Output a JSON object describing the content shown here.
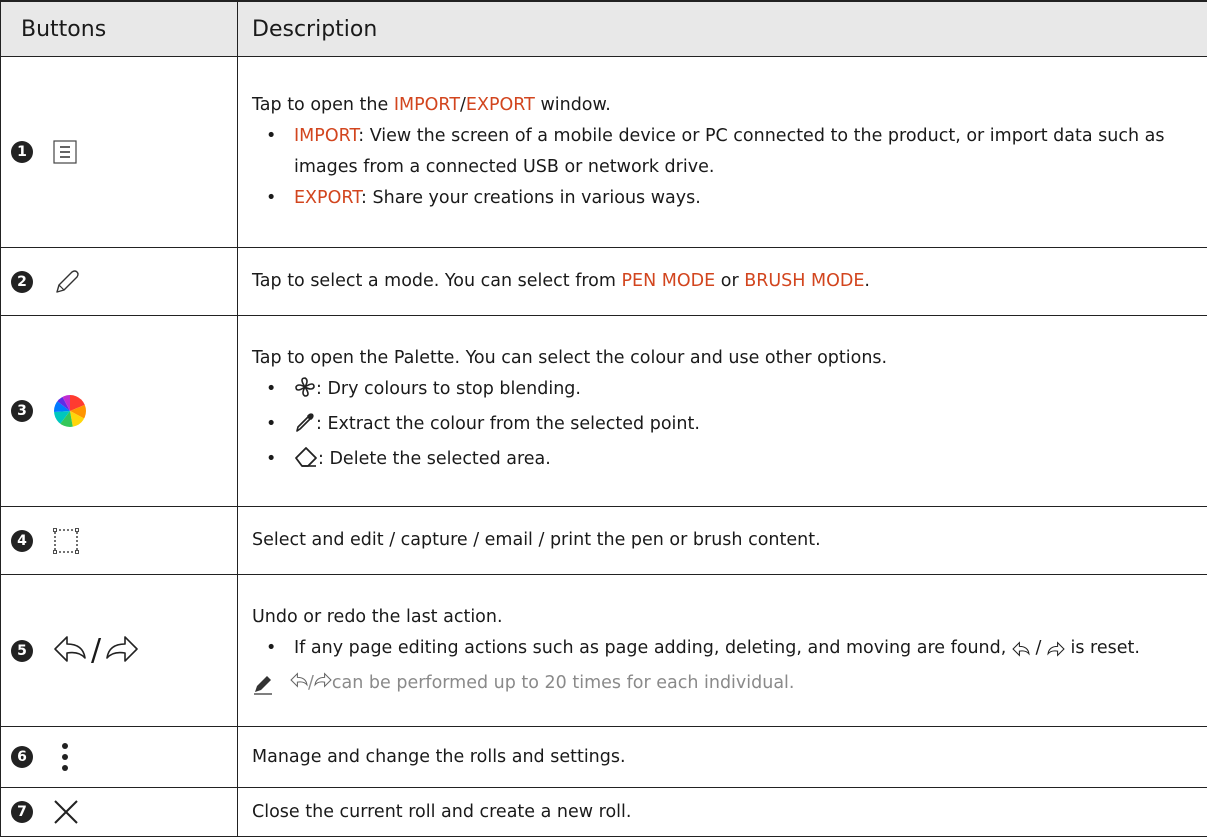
{
  "header": {
    "col1": "Buttons",
    "col2": "Description"
  },
  "rows": [
    {
      "num": "1",
      "intro_pre": "Tap to open the ",
      "intro_hl1": "IMPORT",
      "intro_sep": "/",
      "intro_hl2": "EXPORT",
      "intro_post": " window.",
      "b1_hl": "IMPORT",
      "b1_text": ": View the screen of a mobile device or PC connected to the product, or import data such as images from a connected USB or network drive.",
      "b2_hl": "EXPORT",
      "b2_text": ": Share your creations in various ways."
    },
    {
      "num": "2",
      "pre": "Tap to select a mode. You can select from ",
      "hl1": "PEN MODE",
      "mid": " or ",
      "hl2": "BRUSH MODE",
      "post": "."
    },
    {
      "num": "3",
      "intro": "Tap to open the Palette. You can select the colour and use other options.",
      "b1": ": Dry colours to stop blending.",
      "b2": ": Extract the colour from the selected point.",
      "b3": ": Delete the selected area."
    },
    {
      "num": "4",
      "text": "Select and edit / capture / email / print the pen or brush content."
    },
    {
      "num": "5",
      "slash": "/",
      "intro": "Undo or redo the last action.",
      "b1_pre": "If any page editing actions such as page adding, deleting, and moving are found, ",
      "b1_slash": " / ",
      "b1_post": " is reset.",
      "note_slash": " / ",
      "note_post": " can be performed up to 20 times for each individual."
    },
    {
      "num": "6",
      "text": "Manage and change the rolls and settings."
    },
    {
      "num": "7",
      "text": "Close the current roll and create a new roll."
    }
  ],
  "colors": {
    "highlight": "#d2451e",
    "header_bg": "#e8e8e8",
    "note": "#8a8a8a"
  }
}
